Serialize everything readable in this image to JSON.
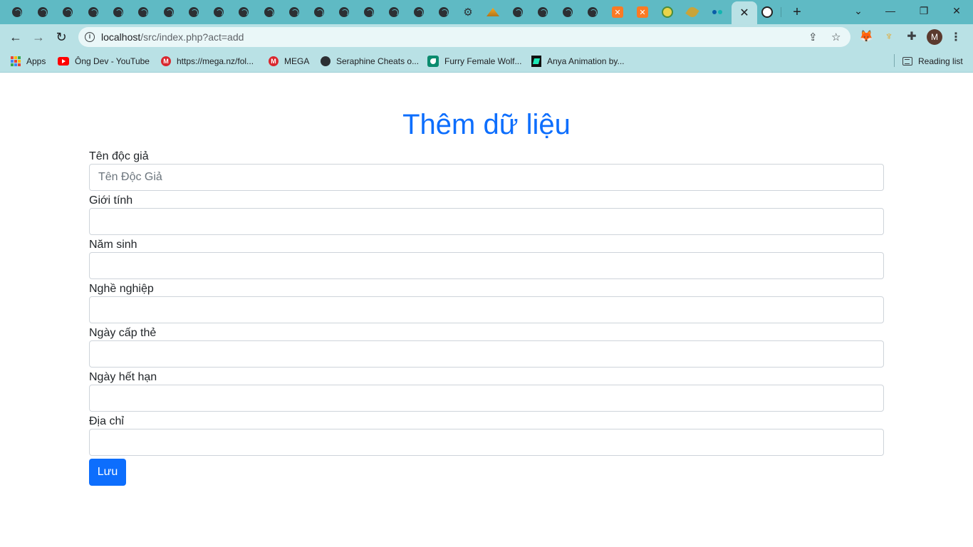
{
  "browser": {
    "url_host": "localhost",
    "url_path": "/src/index.php?act=add",
    "active_tab_close": "✕",
    "new_tab": "+",
    "avatar_letter": "M",
    "window_controls": {
      "minimize": "—",
      "restore": "❐",
      "close": "✕"
    },
    "tab_icons": [
      "globe-icon",
      "globe-icon",
      "globe-icon",
      "globe-icon",
      "globe-icon",
      "globe-icon",
      "globe-icon",
      "globe-icon",
      "globe-icon",
      "globe-icon",
      "globe-icon",
      "globe-icon",
      "globe-icon",
      "globe-icon",
      "globe-icon",
      "globe-icon",
      "globe-icon",
      "globe-icon",
      "gear-icon",
      "phpmyadmin-icon",
      "globe-icon",
      "globe-icon",
      "globe-icon",
      "globe-icon",
      "xampp-icon",
      "xampp-icon",
      "round-logo-icon",
      "feather-icon",
      "dots-icon",
      "github-icon"
    ]
  },
  "bookmarks": [
    {
      "label": "Apps",
      "icon": "apps-grid-icon"
    },
    {
      "label": "Ông Dev - YouTube",
      "icon": "youtube-icon"
    },
    {
      "label": "https://mega.nz/fol...",
      "icon": "mega-icon"
    },
    {
      "label": "MEGA",
      "icon": "mega-icon"
    },
    {
      "label": "Seraphine Cheats o...",
      "icon": "globe-icon"
    },
    {
      "label": "Furry Female Wolf...",
      "icon": "wolf-icon"
    },
    {
      "label": "Anya Animation by...",
      "icon": "anya-icon"
    }
  ],
  "reading_list": "Reading list",
  "page": {
    "title": "Thêm dữ liệu",
    "fields": [
      {
        "label": "Tên độc giả",
        "placeholder": "Tên Độc Giả",
        "value": ""
      },
      {
        "label": "Giới tính",
        "placeholder": "",
        "value": ""
      },
      {
        "label": "Năm sinh",
        "placeholder": "",
        "value": ""
      },
      {
        "label": "Nghề nghiệp",
        "placeholder": "",
        "value": ""
      },
      {
        "label": "Ngày cấp thẻ",
        "placeholder": "",
        "value": ""
      },
      {
        "label": "Ngày hết hạn",
        "placeholder": "",
        "value": ""
      },
      {
        "label": "Địa chỉ",
        "placeholder": "",
        "value": ""
      }
    ],
    "submit_label": "Lưu"
  },
  "colors": {
    "accent": "#0d6efd",
    "tabbar": "#5fbac4",
    "toolbar": "#b9e1e5"
  }
}
